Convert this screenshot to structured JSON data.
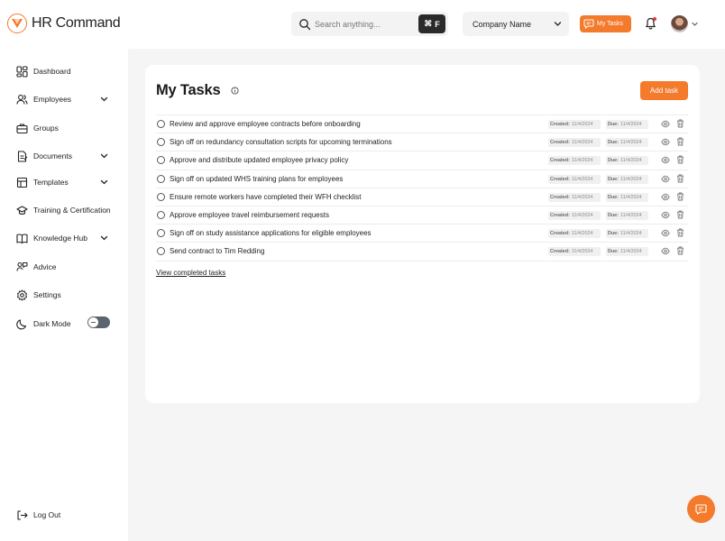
{
  "brand": {
    "name": "HR Command",
    "accent": "#f47a2c",
    "logo_icon": "chevron-v-logo-icon"
  },
  "header": {
    "search_placeholder": "Search anything...",
    "shortcut_symbol": "⌘",
    "shortcut_key": "F",
    "company_select": "Company Name",
    "my_tasks_label": "My Tasks"
  },
  "sidebar": {
    "items": [
      {
        "label": "Dashboard",
        "icon": "dashboard-icon"
      },
      {
        "label": "Employees",
        "icon": "users-icon",
        "expandable": true
      },
      {
        "label": "Groups",
        "icon": "briefcase-icon"
      },
      {
        "label": "Documents",
        "icon": "document-icon",
        "expandable": true
      },
      {
        "label": "Templates",
        "icon": "template-icon",
        "expandable": true
      },
      {
        "label": "Training & Certification",
        "icon": "graduation-cap-icon"
      },
      {
        "label": "Knowledge Hub",
        "icon": "book-icon",
        "expandable": true
      },
      {
        "label": "Advice",
        "icon": "advice-icon"
      },
      {
        "label": "Settings",
        "icon": "gear-icon"
      },
      {
        "label": "Dark Mode",
        "icon": "moon-icon",
        "toggle": "off"
      }
    ],
    "logout_label": "Log Out"
  },
  "main": {
    "title": "My Tasks",
    "add_button": "Add task",
    "created_label": "Created:",
    "due_label": "Due:",
    "view_completed": "View completed tasks",
    "tasks": [
      {
        "title": "Review and approve employee contracts before onboarding",
        "created": "11/4/2024",
        "due": "11/4/2024"
      },
      {
        "title": "Sign off on redundancy consultation scripts for upcoming terminations",
        "created": "11/4/2024",
        "due": "11/4/2024"
      },
      {
        "title": "Approve and distribute updated employee privacy policy",
        "created": "11/4/2024",
        "due": "11/4/2024"
      },
      {
        "title": "Sign off on updated WHS training plans for employees",
        "created": "11/4/2024",
        "due": "11/4/2024"
      },
      {
        "title": "Ensure remote workers have completed their WFH checklist",
        "created": "11/4/2024",
        "due": "11/4/2024"
      },
      {
        "title": "Approve employee travel reimbursement requests",
        "created": "11/4/2024",
        "due": "11/4/2024"
      },
      {
        "title": "Sign off on study assistance applications for eligible employees",
        "created": "11/4/2024",
        "due": "11/4/2024"
      },
      {
        "title": "Send contract to Tim Redding",
        "created": "11/4/2024",
        "due": "11/4/2024"
      }
    ]
  }
}
